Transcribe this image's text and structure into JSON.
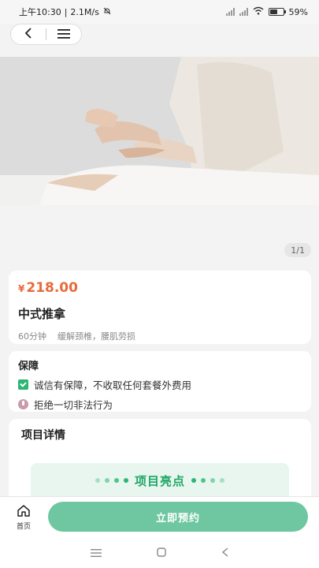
{
  "status_bar": {
    "time": "上午10:30",
    "speed": "2.1M/s",
    "battery_pct": "59%",
    "battery_level": 0.59
  },
  "nav": {
    "back_icon": "chevron-left-icon",
    "menu_icon": "hamburger-menu-icon"
  },
  "hero": {
    "pager": "1/1"
  },
  "service": {
    "currency": "¥",
    "price": "218.00",
    "name": "中式推拿",
    "duration": "60分钟",
    "benefit": "缓解颈椎，腰肌劳损"
  },
  "guarantee": {
    "title": "保障",
    "items": [
      {
        "icon": "shield-check-icon",
        "text": "诚信有保障，不收取任何套餐外费用"
      },
      {
        "icon": "ban-icon",
        "text": "拒绝一切非法行为"
      }
    ]
  },
  "detail": {
    "title": "项目详情",
    "highlight": "项目亮点"
  },
  "bottom_bar": {
    "home_label": "首页",
    "book_label": "立即预约"
  },
  "colors": {
    "price": "#e86a3a",
    "accent_green": "#2bb673",
    "book_button": "#6fc7a1"
  }
}
